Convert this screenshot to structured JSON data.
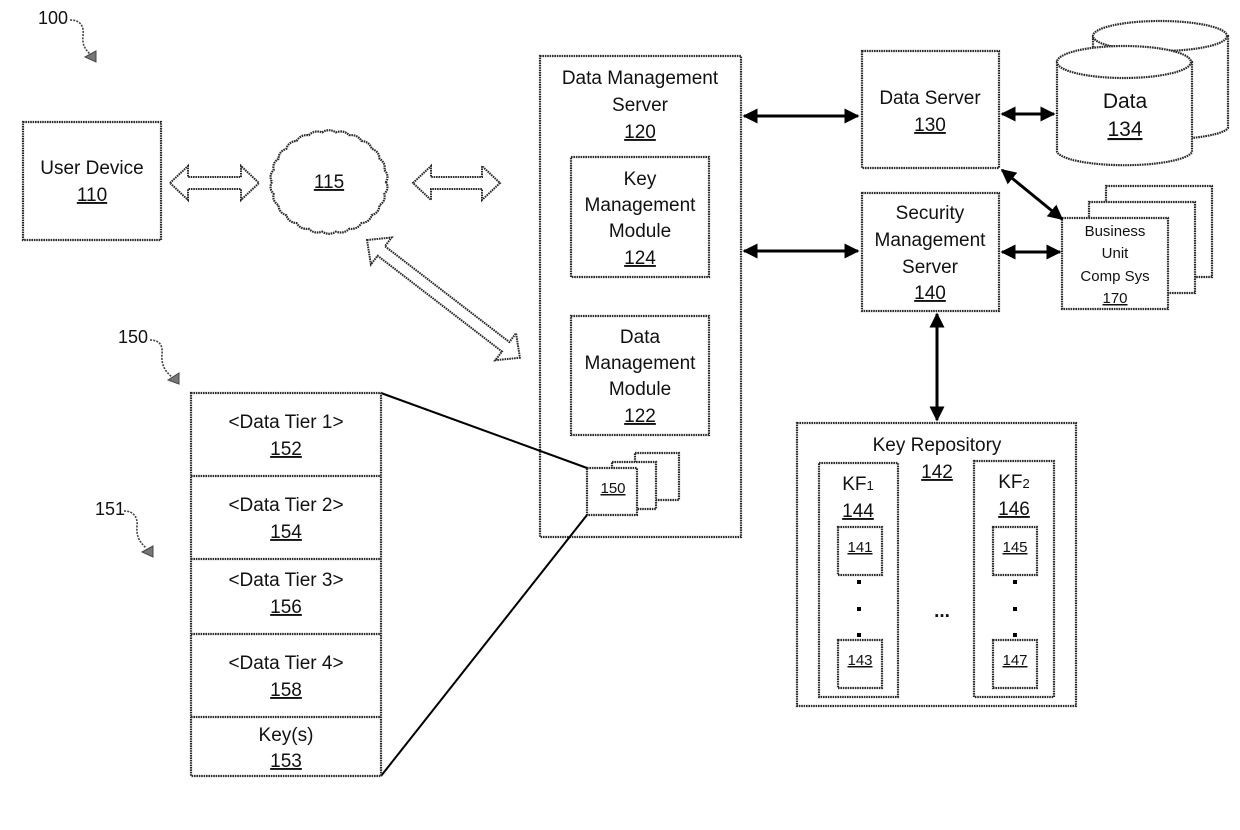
{
  "figure": {
    "reference": "100",
    "ref_tier_stack": "150",
    "ref_tier_item": "151"
  },
  "user_device": {
    "title": "User Device",
    "number": "110"
  },
  "network": {
    "number": "115"
  },
  "data_management_server": {
    "title_line1": "Data Management",
    "title_line2": "Server",
    "number": "120",
    "key_management_module": {
      "line1": "Key",
      "line2": "Management",
      "line3": "Module",
      "number": "124"
    },
    "data_management_module": {
      "line1": "Data",
      "line2": "Management",
      "line3": "Module",
      "number": "122"
    },
    "data_object_stack": {
      "number": "150"
    }
  },
  "data_server": {
    "title": "Data Server",
    "number": "130"
  },
  "data_store": {
    "title": "Data",
    "number": "134"
  },
  "security_management_server": {
    "line1": "Security",
    "line2": "Management",
    "line3": "Server",
    "number": "140"
  },
  "business_unit": {
    "line1": "Business",
    "line2": "Unit",
    "line3": "Comp Sys",
    "number": "170"
  },
  "key_repository": {
    "title": "Key Repository",
    "number": "142",
    "ellipsis": "...",
    "key_files": [
      {
        "label": "KF",
        "subscript": "1",
        "number": "144",
        "keys": [
          "141",
          "143"
        ]
      },
      {
        "label": "KF",
        "subscript": "2",
        "number": "146",
        "keys": [
          "145",
          "147"
        ]
      }
    ]
  },
  "tier_stack": {
    "rows": [
      {
        "label": "<Data Tier 1>",
        "number": "152"
      },
      {
        "label": "<Data Tier 2>",
        "number": "154"
      },
      {
        "label": "<Data Tier 3>",
        "number": "156"
      },
      {
        "label": "<Data Tier 4>",
        "number": "158"
      },
      {
        "label": "Key(s)",
        "number": "153"
      }
    ]
  }
}
